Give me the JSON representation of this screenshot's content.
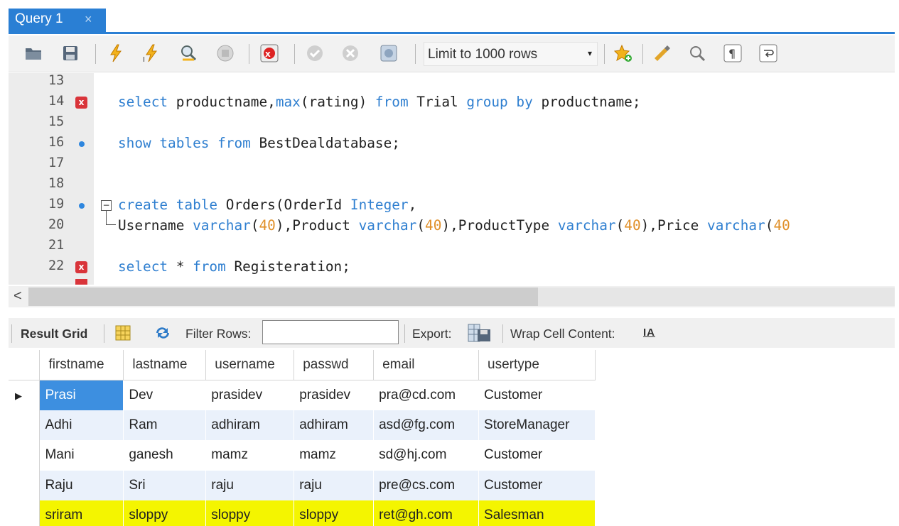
{
  "tab": {
    "label": "Query 1",
    "close": "×"
  },
  "toolbar": {
    "limit_select": "Limit to 1000 rows",
    "limit_arrow": "▾",
    "icons": [
      "open-folder-icon",
      "save-icon",
      "execute-icon",
      "execute-current-icon",
      "explain-icon",
      "stop-icon",
      "toggle-stop-on-error-icon",
      "commit-icon",
      "rollback-icon",
      "autocommit-icon",
      "add-snippet-icon",
      "beautify-icon",
      "find-icon",
      "invisible-chars-icon",
      "wrap-lines-icon"
    ]
  },
  "editor": {
    "lines": [
      {
        "num": "13",
        "marker": ""
      },
      {
        "num": "14",
        "marker": "error"
      },
      {
        "num": "15",
        "marker": ""
      },
      {
        "num": "16",
        "marker": "dot"
      },
      {
        "num": "17",
        "marker": ""
      },
      {
        "num": "18",
        "marker": ""
      },
      {
        "num": "19",
        "marker": "dot"
      },
      {
        "num": "20",
        "marker": ""
      },
      {
        "num": "21",
        "marker": ""
      },
      {
        "num": "22",
        "marker": "error"
      }
    ],
    "code": {
      "l14": [
        {
          "t": "select",
          "k": "kw"
        },
        {
          "t": " productname,",
          "k": ""
        },
        {
          "t": "max",
          "k": "kw"
        },
        {
          "t": "(rating) ",
          "k": ""
        },
        {
          "t": "from",
          "k": "kw"
        },
        {
          "t": " Trial ",
          "k": ""
        },
        {
          "t": "group by",
          "k": "kw"
        },
        {
          "t": " productname;",
          "k": ""
        }
      ],
      "l16": [
        {
          "t": "show tables from",
          "k": "kw"
        },
        {
          "t": " BestDealdatabase;",
          "k": ""
        }
      ],
      "l19": [
        {
          "t": "create table",
          "k": "kw"
        },
        {
          "t": " Orders(OrderId ",
          "k": ""
        },
        {
          "t": "Integer",
          "k": "kw"
        },
        {
          "t": ",",
          "k": ""
        }
      ],
      "l20": [
        {
          "t": "Username ",
          "k": ""
        },
        {
          "t": "varchar",
          "k": "kw"
        },
        {
          "t": "(",
          "k": ""
        },
        {
          "t": "40",
          "k": "num"
        },
        {
          "t": "),Product ",
          "k": ""
        },
        {
          "t": "varchar",
          "k": "kw"
        },
        {
          "t": "(",
          "k": ""
        },
        {
          "t": "40",
          "k": "num"
        },
        {
          "t": "),ProductType ",
          "k": ""
        },
        {
          "t": "varchar",
          "k": "kw"
        },
        {
          "t": "(",
          "k": ""
        },
        {
          "t": "40",
          "k": "num"
        },
        {
          "t": "),Price ",
          "k": ""
        },
        {
          "t": "varchar",
          "k": "kw"
        },
        {
          "t": "(",
          "k": ""
        },
        {
          "t": "40",
          "k": "num"
        }
      ],
      "l22": [
        {
          "t": "select",
          "k": "kw"
        },
        {
          "t": " * ",
          "k": ""
        },
        {
          "t": "from",
          "k": "kw"
        },
        {
          "t": " Registeration;",
          "k": ""
        }
      ]
    }
  },
  "scrollbar": {
    "left_arrow": "<"
  },
  "resultbar": {
    "result_grid": "Result Grid",
    "filter_rows": "Filter Rows:",
    "filter_value": "",
    "export": "Export:",
    "wrap": "Wrap Cell Content:",
    "wrap_icon": "IA"
  },
  "grid": {
    "columns": [
      "firstname",
      "lastname",
      "username",
      "passwd",
      "email",
      "usertype"
    ],
    "rows": [
      [
        "Prasi",
        "Dev",
        "prasidev",
        "prasidev",
        "pra@cd.com",
        "Customer"
      ],
      [
        "Adhi",
        "Ram",
        "adhiram",
        "adhiram",
        "asd@fg.com",
        "StoreManager"
      ],
      [
        "Mani",
        "ganesh",
        "mamz",
        "mamz",
        "sd@hj.com",
        "Customer"
      ],
      [
        "Raju",
        "Sri",
        "raju",
        "raju",
        "pre@cs.com",
        "Customer"
      ],
      [
        "sriram",
        "sloppy",
        "sloppy",
        "sloppy",
        "ret@gh.com",
        "Salesman"
      ]
    ],
    "row_pointer": "▶",
    "selected_cell": "Prasi",
    "highlight_color": "#f4f500"
  }
}
